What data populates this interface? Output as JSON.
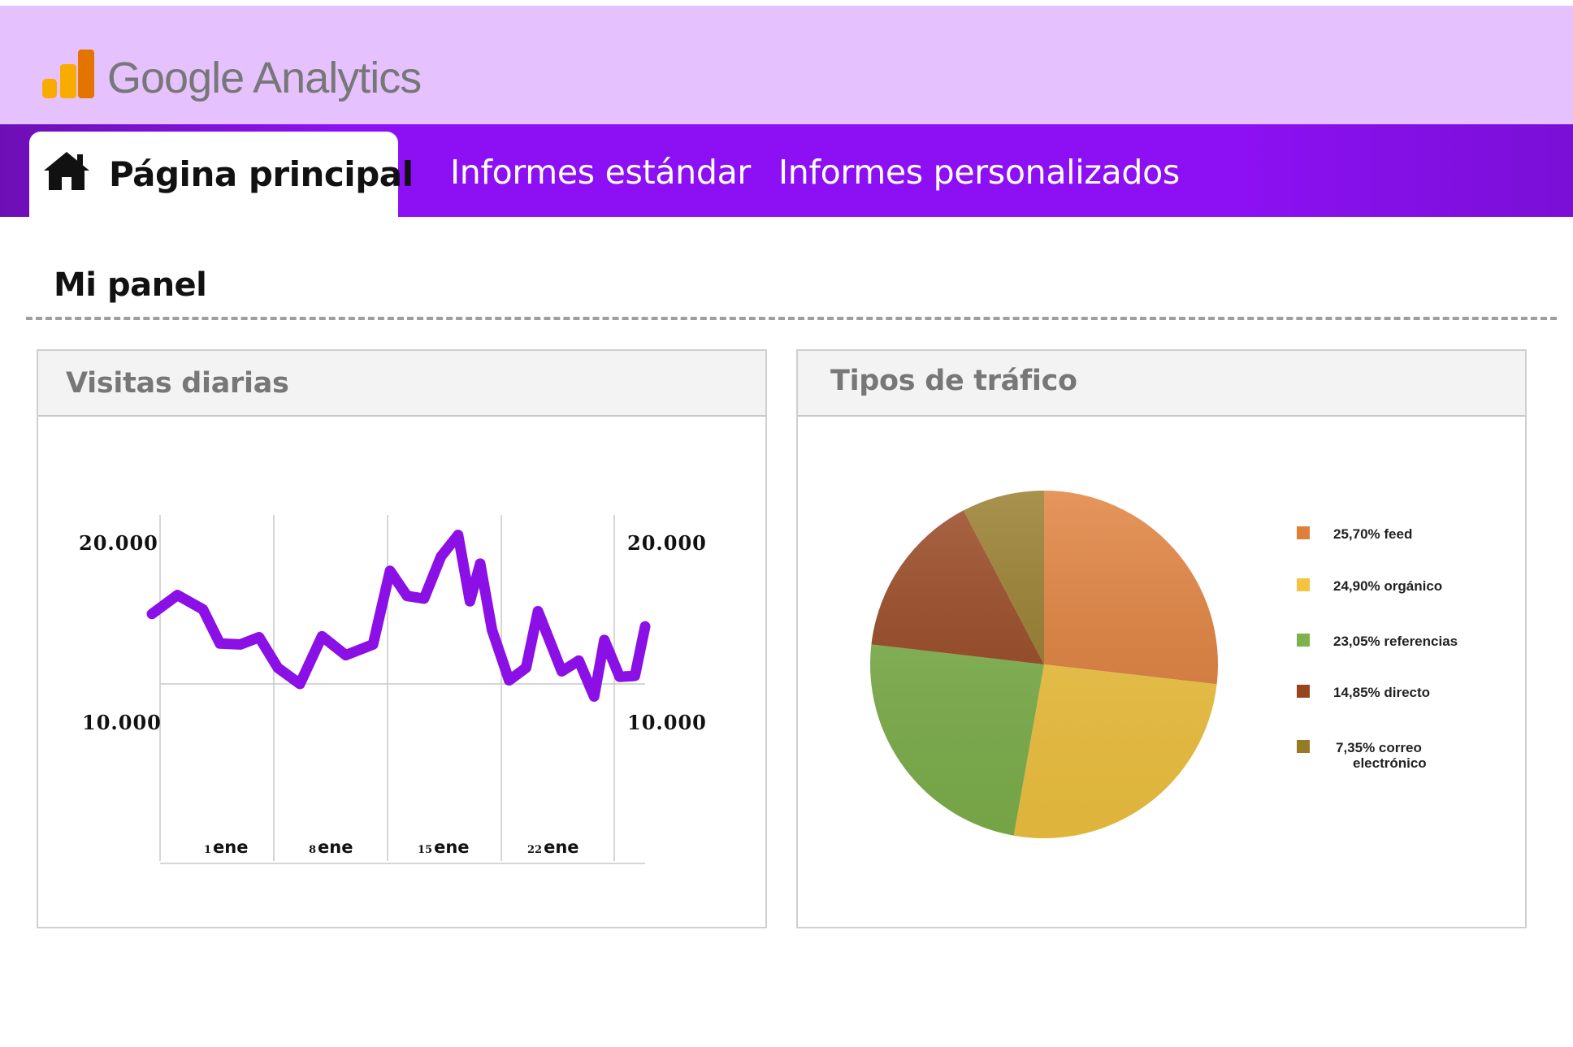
{
  "header": {
    "brand_name": "Google Analytics",
    "logo_icon": "analytics-bars-icon",
    "logo_colors": [
      "#f9ab00",
      "#e37400"
    ]
  },
  "nav": {
    "tabs": [
      {
        "label": "Página principal",
        "icon": "home-icon",
        "active": true
      },
      {
        "label": "Informes estándar",
        "active": false
      },
      {
        "label": "Informes personalizados",
        "active": false
      }
    ]
  },
  "main": {
    "panel_title": "Mi panel"
  },
  "cards": {
    "visits": {
      "title": "Visitas diarias"
    },
    "traffic": {
      "title": "Tipos de tráfico"
    }
  },
  "colors": {
    "header_bg": "#e5c1fd",
    "nav_bg": "#8d10f4",
    "line": "#8b10e6"
  },
  "chart_data": [
    {
      "type": "line",
      "y_ticks_left": [
        "20.000",
        "10.000"
      ],
      "y_ticks_right": [
        "20.000",
        "10.000"
      ],
      "x_ticks": [
        {
          "num": "1",
          "word": "ene"
        },
        {
          "num": "8",
          "word": "ene"
        },
        {
          "num": "15",
          "word": "ene"
        },
        {
          "num": "22",
          "word": "ene"
        }
      ],
      "x": [
        0,
        1.5,
        3,
        4,
        5.2,
        6.3,
        7.4,
        8.7,
        10,
        11.4,
        13,
        14,
        15,
        16,
        17,
        18,
        18.7,
        19.3,
        20,
        21,
        22,
        22.7,
        24.1,
        25.1,
        26,
        26.6,
        27.5,
        28.4,
        29
      ],
      "values": [
        13900,
        14950,
        14150,
        12250,
        12200,
        12600,
        10900,
        10000,
        12650,
        11600,
        12200,
        16300,
        14900,
        14750,
        17100,
        18300,
        14600,
        16700,
        13000,
        10200,
        10900,
        14050,
        10700,
        11300,
        9300,
        12450,
        10400,
        10450,
        13200
      ],
      "ylim": [
        0,
        20000
      ],
      "grid": true
    },
    {
      "type": "pie",
      "slices": [
        {
          "label": "25,70% feed",
          "value": 25.7,
          "color": "#e07f3a"
        },
        {
          "label": "24,90% orgánico",
          "value": 24.9,
          "color": "#f2c440"
        },
        {
          "label": "23,05% referencias",
          "value": 23.05,
          "color": "#7fb24c"
        },
        {
          "label": "14,85% directo",
          "value": 14.85,
          "color": "#97451e"
        },
        {
          "label": "7,35% correo electrónico",
          "value": 7.35,
          "color": "#957a27"
        }
      ],
      "legend_position": "right"
    }
  ]
}
